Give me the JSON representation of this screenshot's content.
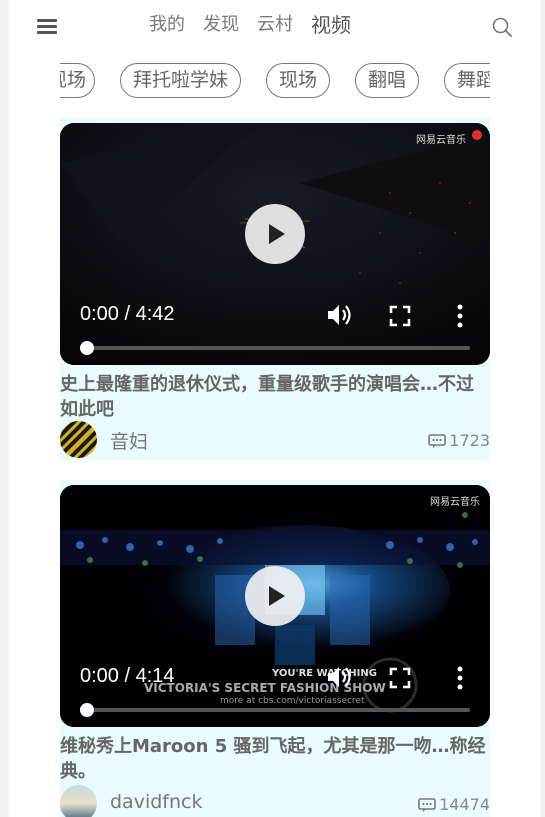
{
  "nav": {
    "menu_icon": "hamburger-menu-icon",
    "tabs": [
      {
        "label": "我的",
        "active": false
      },
      {
        "label": "发现",
        "active": false
      },
      {
        "label": "云村",
        "active": false
      },
      {
        "label": "视频",
        "active": true
      }
    ],
    "search_icon": "search-icon"
  },
  "categories": [
    "现场",
    "拜托啦学妹",
    "现场",
    "翻唱",
    "舞蹈"
  ],
  "videos": [
    {
      "time": "0:00 / 4:42",
      "progress": 0,
      "title": "史上最隆重的退休仪式，重量级歌手的演唱会…不过如此吧",
      "author": "音妇",
      "comments": "1723",
      "watermark": "网易云音乐"
    },
    {
      "time": "0:00 / 4:14",
      "progress": 0,
      "title": "维秘秀上Maroon 5 骚到飞起，尤其是那一吻…称经典。",
      "author": "davidfnck",
      "comments": "14474",
      "watermark": "网易云音乐",
      "overlay_line1": "YOU'RE WATCHING",
      "overlay_line2": "VICTORIA'S SECRET FASHION SHOW",
      "overlay_line3": "more at cbs.com/victoriassecret"
    }
  ]
}
